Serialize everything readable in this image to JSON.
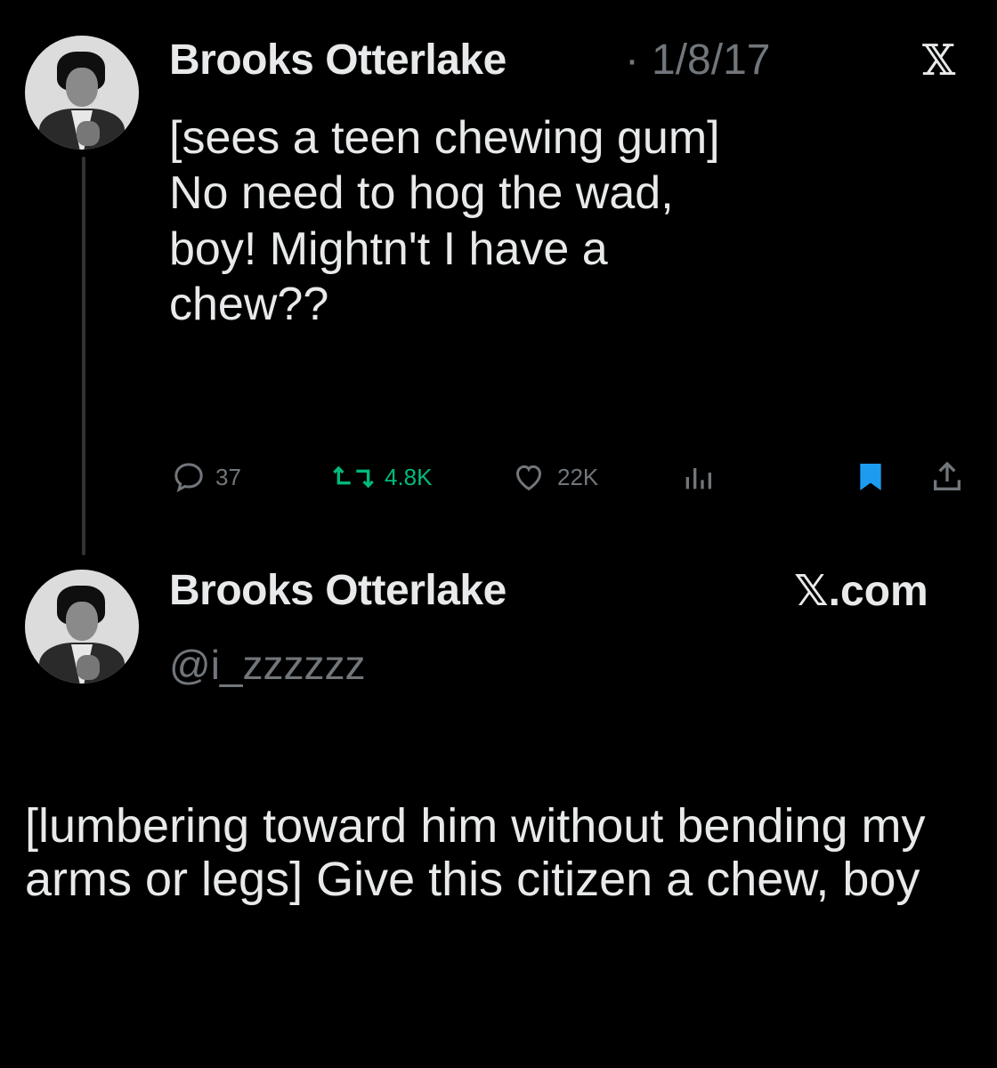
{
  "tweet1": {
    "name": "Brooks Otterlake",
    "separator": "·",
    "date": "1/8/17",
    "x_logo": "𝕏",
    "text_lines": [
      "[sees a teen chewing gum]",
      "No need to hog the wad,",
      "boy! Mightn't I have a",
      "chew??"
    ],
    "actions": {
      "replies": "37",
      "reposts": "4.8K",
      "likes": "22K"
    },
    "colors": {
      "repost": "#00ba7c",
      "bookmark": "#1d9bf0",
      "muted": "#71767b"
    }
  },
  "tweet2": {
    "name": "Brooks Otterlake",
    "handle": "@i_zzzzzz",
    "site": "𝕏.com",
    "text": "[lumbering toward him without bending my arms or legs] Give this citizen a chew, boy"
  }
}
